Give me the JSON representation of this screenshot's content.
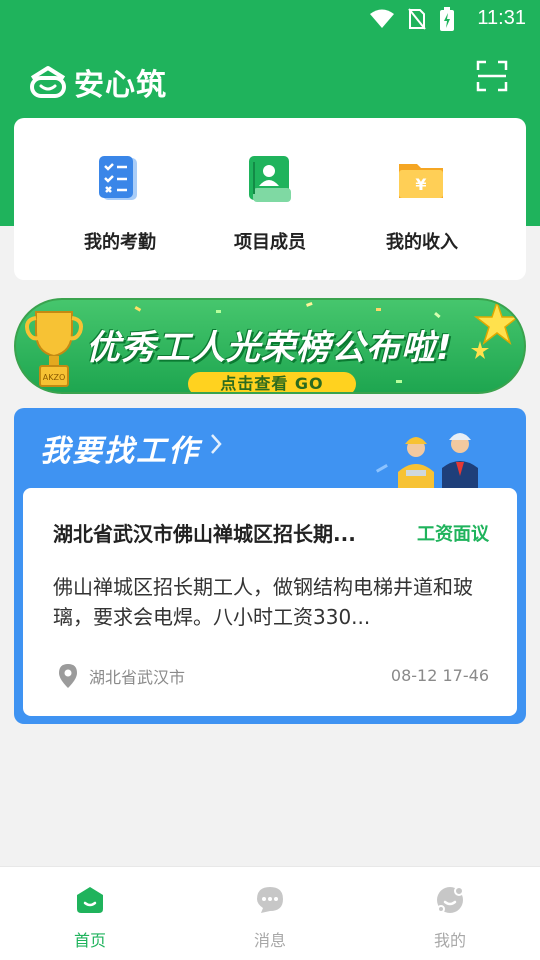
{
  "status_bar": {
    "time": "11:31"
  },
  "header": {
    "app_name": "安心筑",
    "accent": "#1fb35c"
  },
  "quick_actions": [
    {
      "label": "我的考勤",
      "icon": "attendance-icon",
      "color": "#3a86e8"
    },
    {
      "label": "项目成员",
      "icon": "members-icon",
      "color": "#1fb35c"
    },
    {
      "label": "我的收入",
      "icon": "income-icon",
      "color": "#f5a623"
    }
  ],
  "banner": {
    "title": "优秀工人光荣榜公布啦!",
    "cta": "点击查看 GO"
  },
  "job_section": {
    "title": "我要找工作",
    "color": "#3f93f2",
    "job": {
      "title": "湖北省武汉市佛山禅城区招长期...",
      "salary": "工资面议",
      "description": "佛山禅城区招长期工人，做钢结构电梯井道和玻璃，要求会电焊。八小时工资330...",
      "location": "湖北省武汉市",
      "time": "08-12 17-46"
    }
  },
  "tabbar": {
    "items": [
      {
        "label": "首页",
        "icon": "home-icon",
        "active": true
      },
      {
        "label": "消息",
        "icon": "message-icon",
        "active": false
      },
      {
        "label": "我的",
        "icon": "profile-icon",
        "active": false
      }
    ]
  }
}
